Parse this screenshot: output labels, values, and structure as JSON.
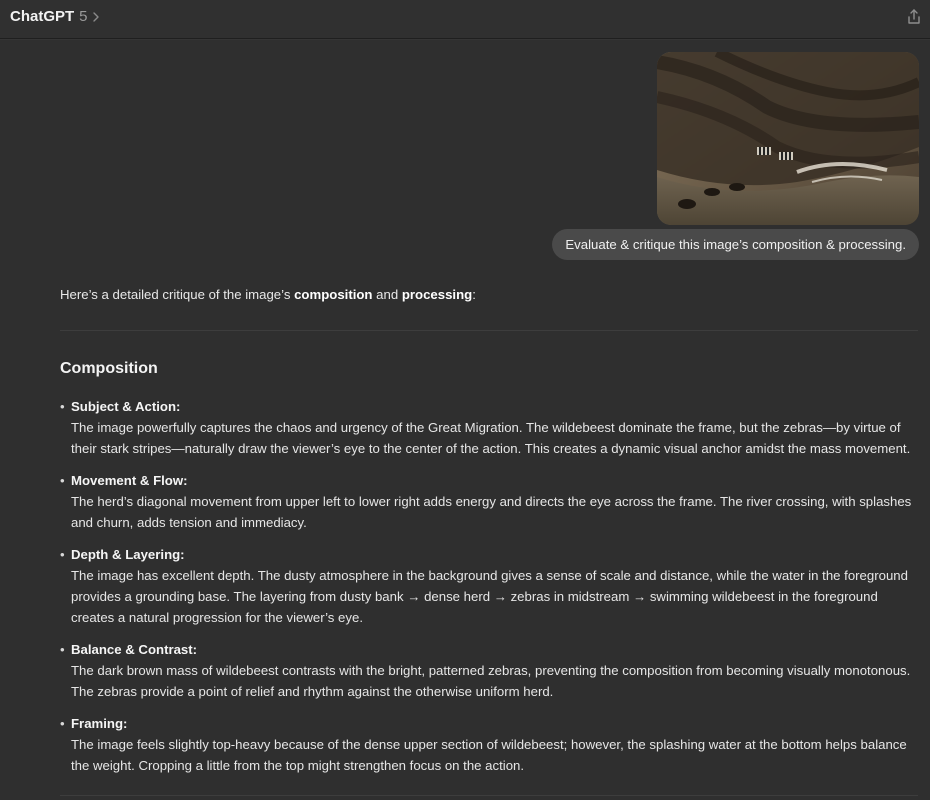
{
  "header": {
    "model_name": "ChatGPT",
    "model_version": "5"
  },
  "conversation": {
    "user_message": "Evaluate & critique this image’s composition & processing.",
    "assistant": {
      "intro_prefix": "Here’s a detailed critique of the image’s ",
      "intro_bold1": "composition",
      "intro_mid": " and ",
      "intro_bold2": "processing",
      "intro_suffix": ":",
      "section_title": "Composition",
      "bullet_marker": "•",
      "bullets": [
        {
          "title": "Subject & Action:",
          "body": "The image powerfully captures the chaos and urgency of the Great Migration. The wildebeest dominate the frame, but the zebras—by virtue of their stark stripes—naturally draw the viewer’s eye to the center of the action. This creates a dynamic visual anchor amidst the mass movement."
        },
        {
          "title": "Movement & Flow:",
          "body": "The herd’s diagonal movement from upper left to lower right adds energy and directs the eye across the frame. The river crossing, with splashes and churn, adds tension and immediacy."
        },
        {
          "title": "Depth & Layering:",
          "body": "The image has excellent depth. The dusty atmosphere in the background gives a sense of scale and distance, while the water in the foreground provides a grounding base. The layering from dusty bank → dense herd → zebras in midstream → swimming wildebeest in the foreground creates a natural progression for the viewer’s eye."
        },
        {
          "title": "Balance & Contrast:",
          "body": "The dark brown mass of wildebeest contrasts with the bright, patterned zebras, preventing the composition from becoming visually monotonous. The zebras provide a point of relief and rhythm against the otherwise uniform herd."
        },
        {
          "title": "Framing:",
          "body": "The image feels slightly top-heavy because of the dense upper section of wildebeest; however, the splashing water at the bottom helps balance the weight. Cropping a little from the top might strengthen focus on the action."
        }
      ]
    }
  },
  "icons": {
    "chevron": "chevron-right-icon",
    "share": "share-icon"
  },
  "colors": {
    "background": "#2f2f2f",
    "user_bubble": "#4a4a4a",
    "text": "#ececec"
  }
}
